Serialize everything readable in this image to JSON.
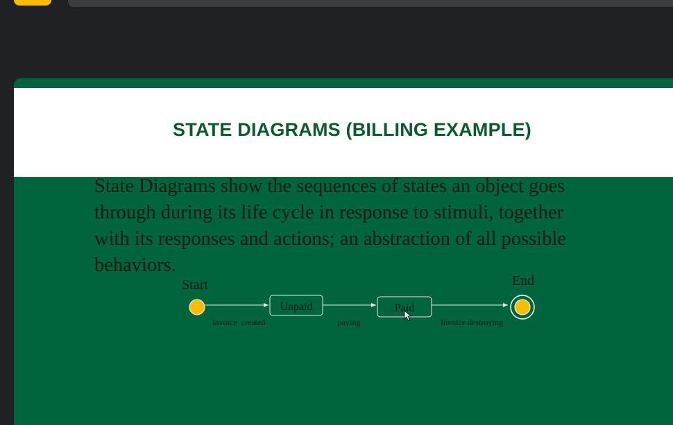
{
  "slide": {
    "title": "STATE DIAGRAMS (BILLING EXAMPLE)",
    "body": "State Diagrams show the sequences of states an object goes through during its life cycle in response to stimuli, together with its responses and actions; an abstraction of all possible behaviors."
  },
  "diagram": {
    "start_label": "Start",
    "end_label": "End",
    "states": [
      "Unpaid",
      "Paid"
    ],
    "transitions": [
      "Invoice  created",
      "paying",
      "Invoice destroying"
    ]
  },
  "colors": {
    "slide_bg": "#00643c",
    "title_text": "#0b5a32",
    "node_fill": "#fbbc04",
    "page_bg": "#202124"
  },
  "icons": [
    "mouse-cursor-icon"
  ]
}
